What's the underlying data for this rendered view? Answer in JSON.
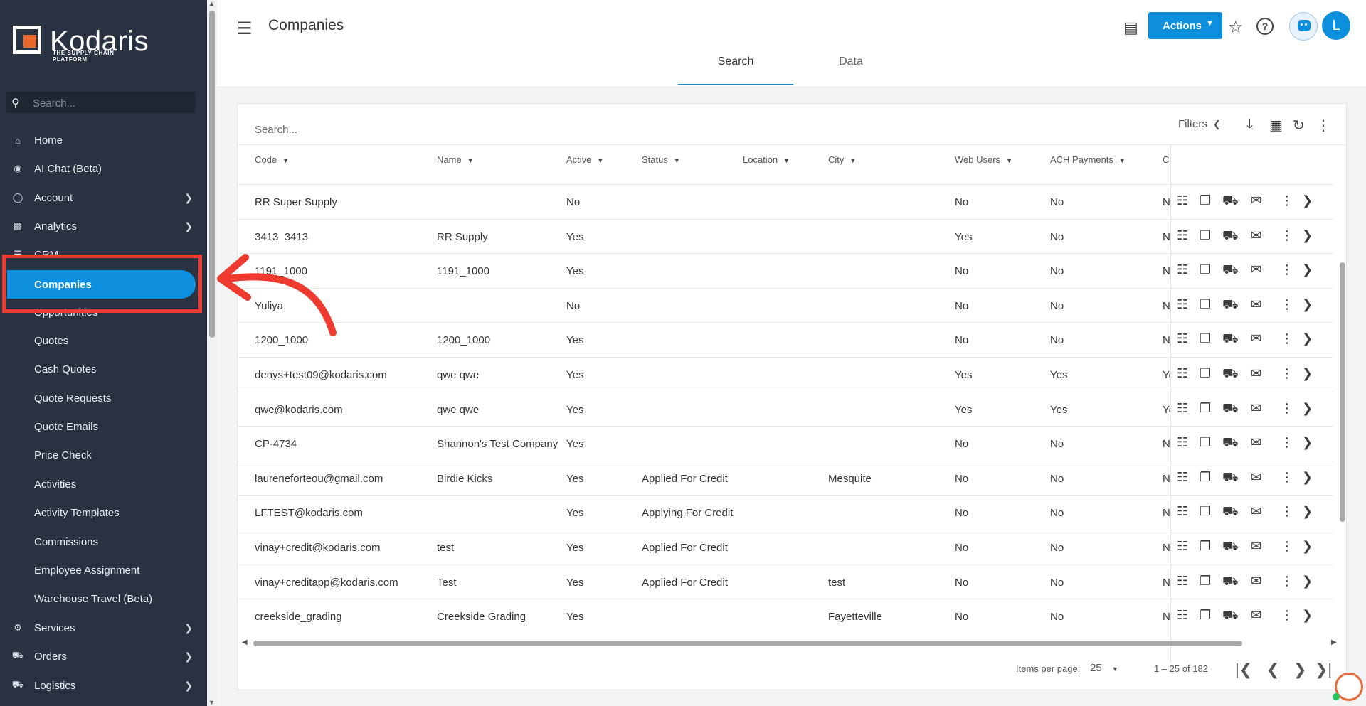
{
  "brand": {
    "name": "Kodaris",
    "tagline": "THE SUPPLY CHAIN PLATFORM",
    "accent": "#0d8fdd",
    "sidebar_bg": "#283241",
    "annotation": "#ee3a2f"
  },
  "sidebar": {
    "search_placeholder": "Search...",
    "items": [
      {
        "label": "Home",
        "icon": "home-icon"
      },
      {
        "label": "AI Chat (Beta)",
        "icon": "robot-icon"
      },
      {
        "label": "Account",
        "icon": "person-icon"
      },
      {
        "label": "Analytics",
        "icon": "chart-icon"
      },
      {
        "label": "CRM",
        "icon": "crm-icon"
      },
      {
        "label": "Companies"
      },
      {
        "label": "Opportunities"
      },
      {
        "label": "Quotes"
      },
      {
        "label": "Cash Quotes"
      },
      {
        "label": "Quote Requests"
      },
      {
        "label": "Quote Emails"
      },
      {
        "label": "Price Check"
      },
      {
        "label": "Activities"
      },
      {
        "label": "Activity Templates"
      },
      {
        "label": "Commissions"
      },
      {
        "label": "Employee Assignment"
      },
      {
        "label": "Warehouse Travel (Beta)"
      },
      {
        "label": "Services",
        "icon": "gears-icon"
      },
      {
        "label": "Orders",
        "icon": "truck-icon"
      },
      {
        "label": "Logistics",
        "icon": "shipping-icon"
      }
    ]
  },
  "header": {
    "title": "Companies",
    "actions_label": "Actions",
    "avatar_initial": "L",
    "tabs": [
      "Search",
      "Data"
    ]
  },
  "toolbar": {
    "search_placeholder": "Search...",
    "filters_label": "Filters"
  },
  "table": {
    "columns": [
      "Code",
      "Name",
      "Active",
      "Status",
      "Location",
      "City",
      "Web Users",
      "ACH Payments",
      "Co"
    ],
    "rows": [
      {
        "code": "RR Super Supply",
        "name": "",
        "active": "No",
        "status": "",
        "location": "",
        "city": "",
        "web_users": "No",
        "ach": "No",
        "extra": "No"
      },
      {
        "code": "3413_3413",
        "name": "RR Supply",
        "active": "Yes",
        "status": "",
        "location": "",
        "city": "",
        "web_users": "Yes",
        "ach": "No",
        "extra": "No"
      },
      {
        "code": "1191_1000",
        "name": "1191_1000",
        "active": "Yes",
        "status": "",
        "location": "",
        "city": "",
        "web_users": "No",
        "ach": "No",
        "extra": "No"
      },
      {
        "code": "Yuliya",
        "name": "",
        "active": "No",
        "status": "",
        "location": "",
        "city": "",
        "web_users": "No",
        "ach": "No",
        "extra": "No"
      },
      {
        "code": "1200_1000",
        "name": "1200_1000",
        "active": "Yes",
        "status": "",
        "location": "",
        "city": "",
        "web_users": "No",
        "ach": "No",
        "extra": "No"
      },
      {
        "code": "denys+test09@kodaris.com",
        "name": "qwe qwe",
        "active": "Yes",
        "status": "",
        "location": "",
        "city": "",
        "web_users": "Yes",
        "ach": "Yes",
        "extra": "Yes"
      },
      {
        "code": "qwe@kodaris.com",
        "name": "qwe qwe",
        "active": "Yes",
        "status": "",
        "location": "",
        "city": "",
        "web_users": "Yes",
        "ach": "Yes",
        "extra": "Yes"
      },
      {
        "code": "CP-4734",
        "name": "Shannon's Test Company",
        "active": "Yes",
        "status": "",
        "location": "",
        "city": "",
        "web_users": "No",
        "ach": "No",
        "extra": "No"
      },
      {
        "code": "laureneforteou@gmail.com",
        "name": "Birdie Kicks",
        "active": "Yes",
        "status": "Applied For Credit",
        "location": "",
        "city": "Mesquite",
        "web_users": "No",
        "ach": "No",
        "extra": "No"
      },
      {
        "code": "LFTEST@kodaris.com",
        "name": "",
        "active": "Yes",
        "status": "Applying For Credit",
        "location": "",
        "city": "",
        "web_users": "No",
        "ach": "No",
        "extra": "No"
      },
      {
        "code": "vinay+credit@kodaris.com",
        "name": "test",
        "active": "Yes",
        "status": "Applied For Credit",
        "location": "",
        "city": "",
        "web_users": "No",
        "ach": "No",
        "extra": "No"
      },
      {
        "code": "vinay+creditapp@kodaris.com",
        "name": "Test",
        "active": "Yes",
        "status": "Applied For Credit",
        "location": "",
        "city": "test",
        "web_users": "No",
        "ach": "No",
        "extra": "No"
      },
      {
        "code": "creekside_grading",
        "name": "Creekside Grading",
        "active": "Yes",
        "status": "",
        "location": "",
        "city": "Fayetteville",
        "web_users": "No",
        "ach": "No",
        "extra": "No"
      }
    ]
  },
  "pagination": {
    "items_per_page_label": "Items per page:",
    "page_size": "25",
    "range": "1 – 25 of 182"
  }
}
